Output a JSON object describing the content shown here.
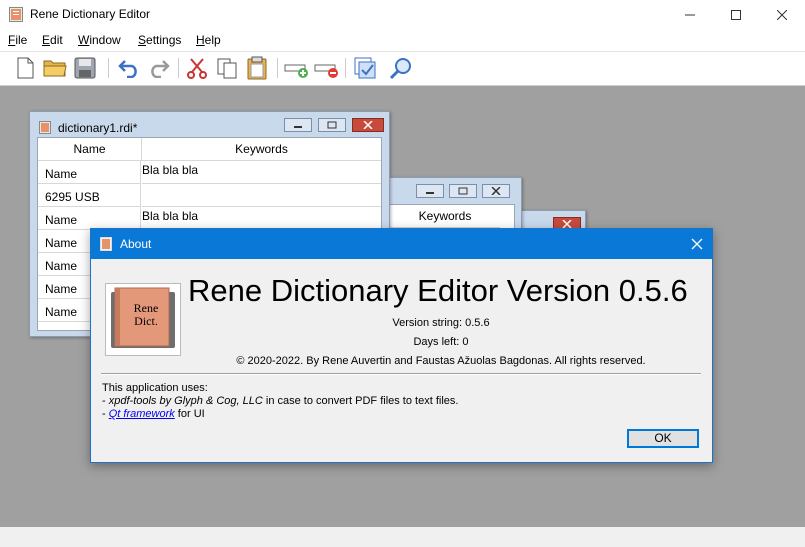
{
  "app": {
    "title": "Rene Dictionary Editor"
  },
  "menu": [
    "File",
    "Edit",
    "Window",
    "Settings",
    "Help"
  ],
  "toolbar": {
    "icons": [
      "new-file-icon",
      "open-folder-icon",
      "save-icon",
      "undo-icon",
      "redo-icon",
      "cut-icon",
      "copy-icon",
      "paste-icon",
      "add-row-icon",
      "remove-row-icon",
      "check-icon",
      "search-icon"
    ]
  },
  "doc1": {
    "title": "dictionary1.rdi*",
    "headers": [
      "Name",
      "Keywords"
    ],
    "rows": [
      {
        "name": "Name",
        "keywords": "Bla bla bla"
      },
      {
        "name": "6295 USB",
        "keywords": ""
      },
      {
        "name": "Name",
        "keywords": "Bla bla bla"
      },
      {
        "name": "Name",
        "keywords": ""
      },
      {
        "name": "Name",
        "keywords": ""
      },
      {
        "name": "Name",
        "keywords": ""
      },
      {
        "name": "Name",
        "keywords": ""
      }
    ]
  },
  "doc2": {
    "headers": [
      "Keywords"
    ]
  },
  "about": {
    "title": "About",
    "icon_text_1": "Rene",
    "icon_text_2": "Dict.",
    "heading": "Rene Dictionary Editor Version 0.5.6",
    "version_string": "Version string: 0.5.6",
    "days_left": "Days left: 0",
    "copyright": "© 2020-2022. By Rene Auvertin and Faustas Ažuolas Bagdonas. All rights reserved.",
    "uses_intro": "This application uses:",
    "uses_1_dash": "- ",
    "uses_1_italic": "xpdf-tools by Glyph & Cog, LLC",
    "uses_1_rest": " in case to convert PDF files to text files.",
    "uses_2_dash": "- ",
    "uses_2_link": "Qt framework",
    "uses_2_rest": " for UI",
    "ok": "OK"
  },
  "colors": {
    "accent": "#0a78d7",
    "workspace": "#a0a0a0",
    "mdi_frame": "#c9d9ec"
  }
}
